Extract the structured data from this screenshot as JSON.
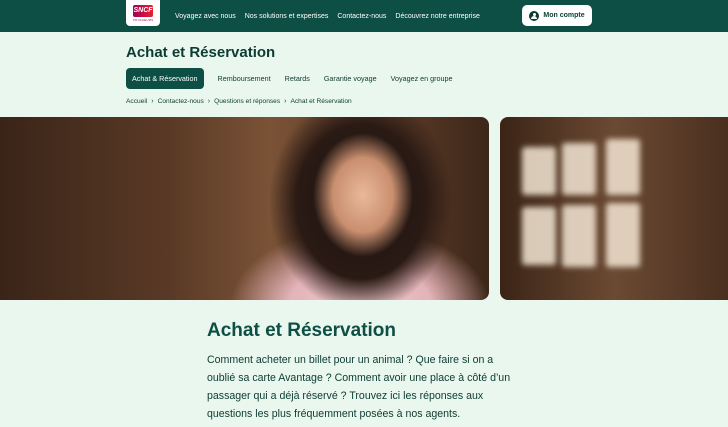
{
  "brand": {
    "logo_text": "SNCF",
    "logo_subtitle": "VOYAGEURS"
  },
  "topnav": {
    "items": [
      "Voyagez avec nous",
      "Nos solutions et expertises",
      "Contactez-nous",
      "Découvrez notre entreprise"
    ],
    "account_label": "Mon compte"
  },
  "page": {
    "title": "Achat et Réservation",
    "tabs": [
      {
        "label": "Achat & Réservation",
        "active": true
      },
      {
        "label": "Remboursement",
        "active": false
      },
      {
        "label": "Retards",
        "active": false
      },
      {
        "label": "Garantie voyage",
        "active": false
      },
      {
        "label": "Voyagez en groupe",
        "active": false
      }
    ],
    "breadcrumb": [
      "Accueil",
      "Contactez-nous",
      "Questions et réponses",
      "Achat et Réservation"
    ]
  },
  "content": {
    "heading": "Achat et Réservation",
    "intro": "Comment acheter un billet pour un animal ? Que faire si on a oublié sa carte Avantage ? Comment avoir une place à côté d’un passager qui a déjà réservé ? Trouvez ici les réponses aux questions les plus fréquemment posées à nos agents."
  },
  "colors": {
    "primary": "#0d4f45",
    "background": "#eaf7ee",
    "text": "#0c3b33"
  }
}
